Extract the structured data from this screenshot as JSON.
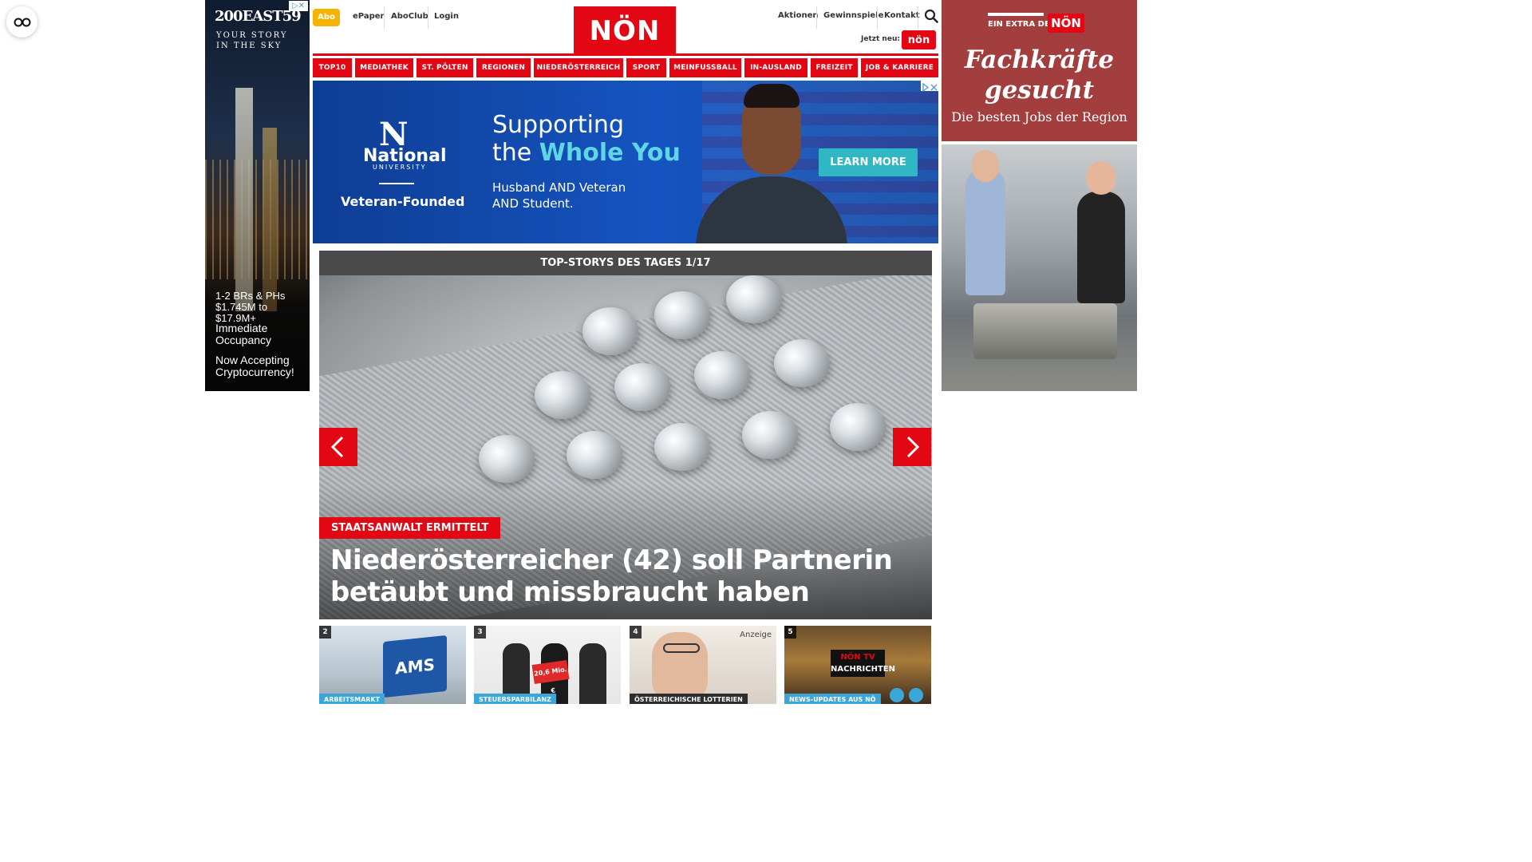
{
  "accessibility": {
    "icon": "glasses-icon"
  },
  "left_ad": {
    "brand": "200EAST59",
    "tagline_1": "YOUR STORY",
    "tagline_2": "IN THE SKY",
    "info_1": "1-2 BRs & PHs",
    "info_2": "$1.745M to $17.9M+",
    "info_3": "Immediate",
    "info_4": "Occupancy",
    "info_5": "Now Accepting",
    "info_6": "Cryptocurrency!"
  },
  "header": {
    "abo": "Abo",
    "links_left": [
      "ePaper",
      "AboClub",
      "Login"
    ],
    "logo": "NÖN",
    "links_right": [
      "Aktionen",
      "Gewinnspiele",
      "Kontakt"
    ],
    "jetzt_label": "Jetzt neu:",
    "jetzt_badge": "nön",
    "brand_color": "#e30613"
  },
  "nav": [
    "TOP10",
    "MEDIATHEK",
    "ST. PÖLTEN",
    "REGIONEN",
    "NIEDERÖSTERREICH",
    "SPORT",
    "MEINFUSSBALL",
    "IN-AUSLAND",
    "FREIZEIT",
    "JOB & KARRIERE"
  ],
  "banner_ad": {
    "logo_mark": "N",
    "org": "National",
    "org_sub": "UNIVERSITY",
    "founded": "Veteran-Founded",
    "headline_1": "Supporting",
    "headline_2a": "the ",
    "headline_2b": "Whole You",
    "sub_1": "Husband AND Veteran",
    "sub_2": "AND Student.",
    "cta": "LEARN MORE"
  },
  "right_ad": {
    "extra_label": "EIN EXTRA DER",
    "extra_logo": "NÖN",
    "headline_1": "Fachkräfte",
    "headline_2": "gesucht",
    "subline": "Die besten Jobs der Region"
  },
  "top_stories": {
    "header": "TOP-STORYS DES TAGES 1/17",
    "kicker": "STAATSANWALT ERMITTELT",
    "title": "Niederösterreicher (42) soll Partnerin betäubt und missbraucht haben"
  },
  "cards": [
    {
      "num": "2",
      "label": "ARBEITSMARKT",
      "ams": "AMS"
    },
    {
      "num": "3",
      "label": "STEUERSPARBILANZ",
      "sign": "20,6 Mio.€"
    },
    {
      "num": "4",
      "label": "ÖSTERREICHISCHE LOTTERIEN",
      "anzeige": "Anzeige"
    },
    {
      "num": "5",
      "label": "NEWS-UPDATES AUS NÖ",
      "tv_1": "NÖN TV",
      "tv_2": "NACHRICHTEN"
    }
  ]
}
